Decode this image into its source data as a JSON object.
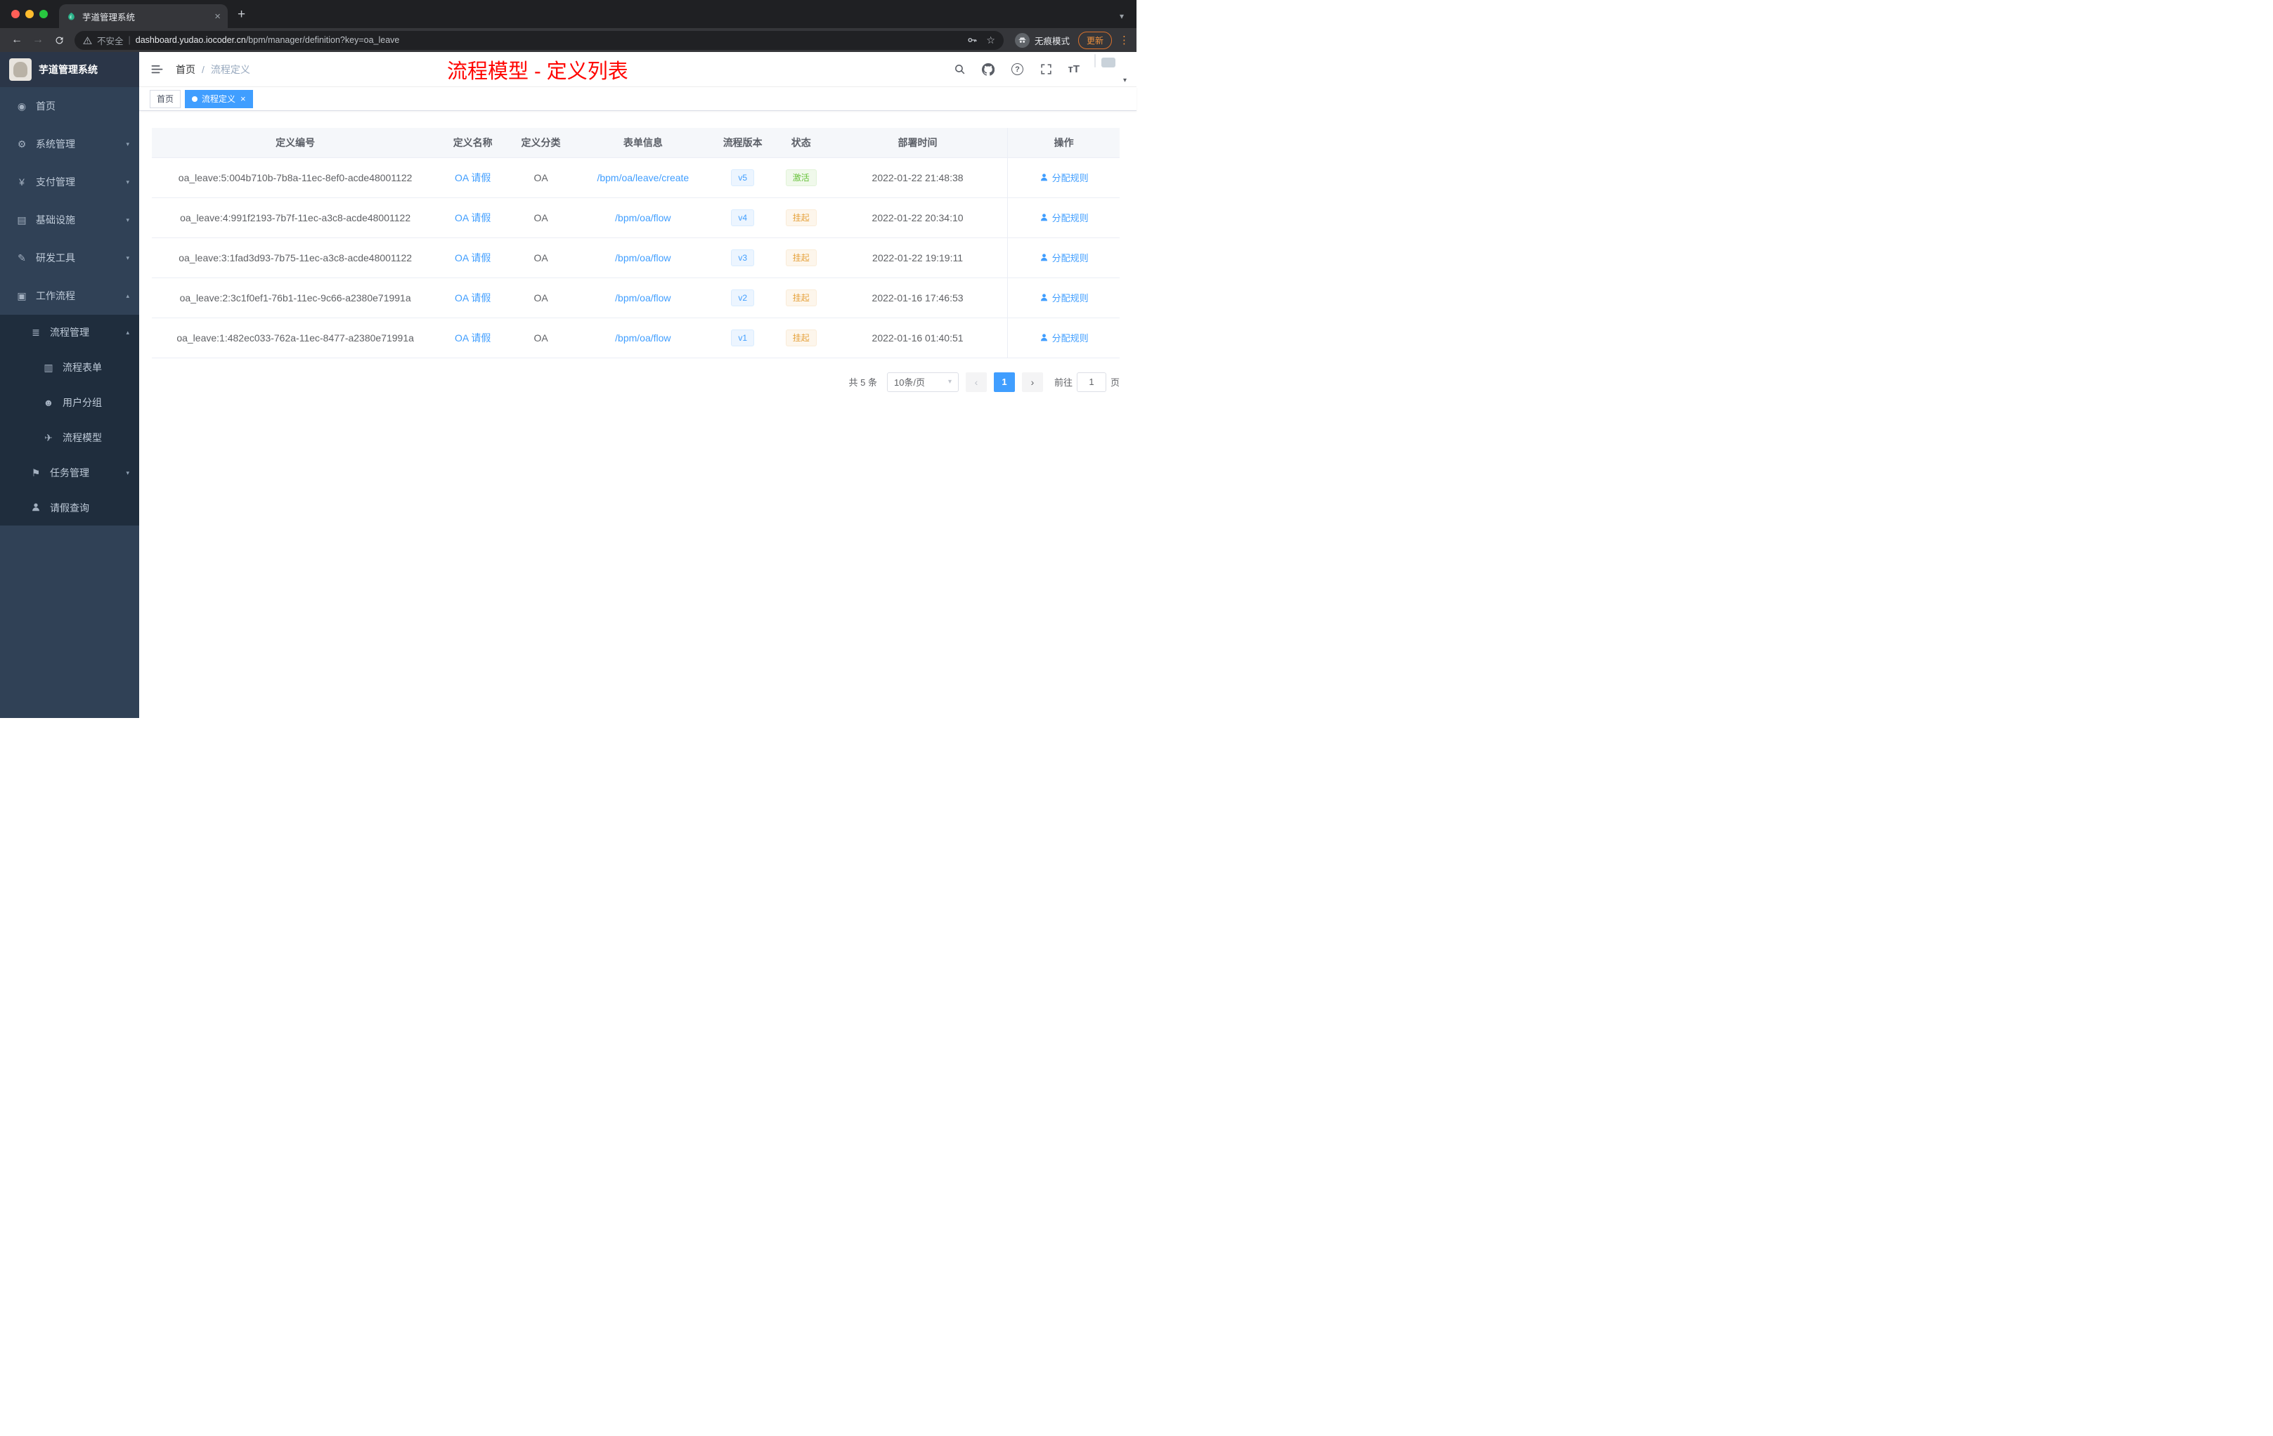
{
  "browser": {
    "tab_title": "芋道管理系统",
    "security_label": "不安全",
    "url_domain": "dashboard.yudao.iocoder.cn",
    "url_path": "/bpm/manager/definition?key=oa_leave",
    "incognito_label": "无痕模式",
    "update_label": "更新"
  },
  "sidebar": {
    "logo_title": "芋道管理系统",
    "items": [
      {
        "icon": "◉",
        "label": "首页",
        "arrow": ""
      },
      {
        "icon": "⚙",
        "label": "系统管理",
        "arrow": "▾"
      },
      {
        "icon": "¥",
        "label": "支付管理",
        "arrow": "▾"
      },
      {
        "icon": "▤",
        "label": "基础设施",
        "arrow": "▾"
      },
      {
        "icon": "✎",
        "label": "研发工具",
        "arrow": "▾"
      },
      {
        "icon": "▣",
        "label": "工作流程",
        "arrow": "▴"
      }
    ],
    "process_mgmt": {
      "icon": "≣",
      "label": "流程管理",
      "arrow": "▴"
    },
    "process_children": [
      {
        "icon": "▥",
        "label": "流程表单"
      },
      {
        "icon": "☻",
        "label": "用户分组"
      },
      {
        "icon": "✈",
        "label": "流程模型"
      }
    ],
    "task_mgmt": {
      "icon": "⚑",
      "label": "任务管理",
      "arrow": "▾"
    },
    "leave_query": {
      "label": "请假查询"
    }
  },
  "header": {
    "breadcrumb_home": "首页",
    "breadcrumb_sep": "/",
    "breadcrumb_current": "流程定义",
    "annotation": "流程模型 - 定义列表",
    "font_size_icon": "тT"
  },
  "tags": {
    "home": "首页",
    "current": "流程定义",
    "close": "×"
  },
  "table": {
    "columns": [
      "定义编号",
      "定义名称",
      "定义分类",
      "表单信息",
      "流程版本",
      "状态",
      "部署时间",
      "操作"
    ],
    "rows": [
      {
        "id": "oa_leave:5:004b710b-7b8a-11ec-8ef0-acde48001122",
        "name": "OA 请假",
        "category": "OA",
        "form": "/bpm/oa/leave/create",
        "version": "v5",
        "status": "激活",
        "status_type": "success",
        "time": "2022-01-22 21:48:38",
        "action": "分配规则"
      },
      {
        "id": "oa_leave:4:991f2193-7b7f-11ec-a3c8-acde48001122",
        "name": "OA 请假",
        "category": "OA",
        "form": "/bpm/oa/flow",
        "version": "v4",
        "status": "挂起",
        "status_type": "warning",
        "time": "2022-01-22 20:34:10",
        "action": "分配规则"
      },
      {
        "id": "oa_leave:3:1fad3d93-7b75-11ec-a3c8-acde48001122",
        "name": "OA 请假",
        "category": "OA",
        "form": "/bpm/oa/flow",
        "version": "v3",
        "status": "挂起",
        "status_type": "warning",
        "time": "2022-01-22 19:19:11",
        "action": "分配规则"
      },
      {
        "id": "oa_leave:2:3c1f0ef1-76b1-11ec-9c66-a2380e71991a",
        "name": "OA 请假",
        "category": "OA",
        "form": "/bpm/oa/flow",
        "version": "v2",
        "status": "挂起",
        "status_type": "warning",
        "time": "2022-01-16 17:46:53",
        "action": "分配规则"
      },
      {
        "id": "oa_leave:1:482ec033-762a-11ec-8477-a2380e71991a",
        "name": "OA 请假",
        "category": "OA",
        "form": "/bpm/oa/flow",
        "version": "v1",
        "status": "挂起",
        "status_type": "warning",
        "time": "2022-01-16 01:40:51",
        "action": "分配规则"
      }
    ]
  },
  "pagination": {
    "total": "共 5 条",
    "page_size": "10条/页",
    "prev": "‹",
    "page": "1",
    "next": "›",
    "goto_label": "前往",
    "goto_value": "1",
    "unit": "页"
  },
  "colors": {
    "accent": "#409eff",
    "success": "#67c23a",
    "warning": "#e6a23c",
    "annotation_red": "#ff0400",
    "sidebar_bg": "#304156",
    "submenu_bg": "#1f2d3d"
  }
}
